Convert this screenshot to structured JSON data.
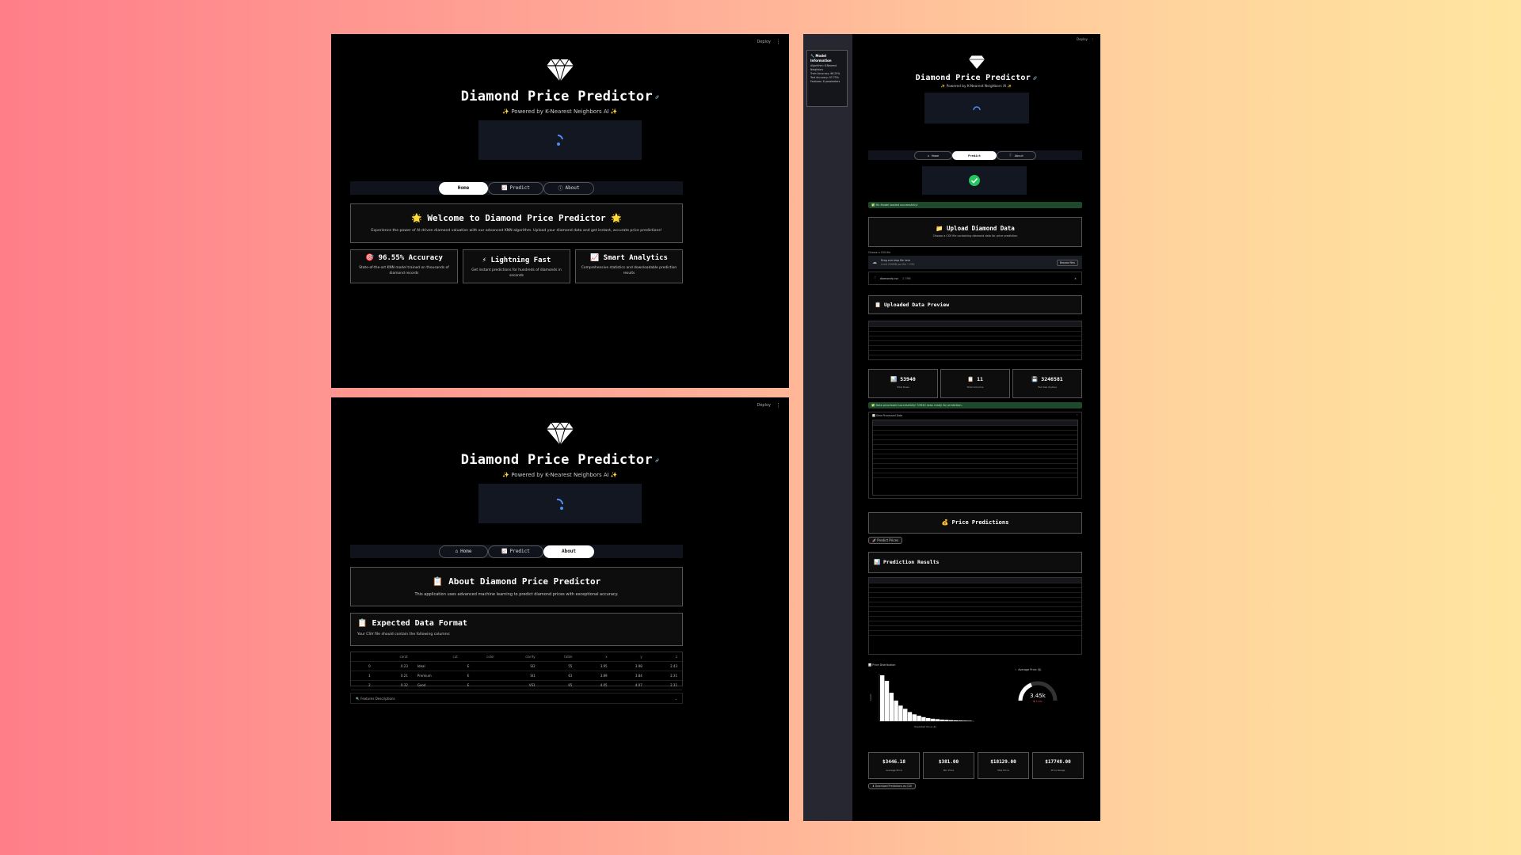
{
  "app": {
    "title": "Diamond Price Predictor",
    "subtitle": "✨ Powered by K-Nearest Neighbors AI ✨",
    "deploy_label": "Deploy",
    "menu_glyph": "⋮"
  },
  "tabs": [
    {
      "label": "Home",
      "icon": "home-icon"
    },
    {
      "label": "Predict",
      "icon": "chart-icon"
    },
    {
      "label": "About",
      "icon": "info-icon"
    }
  ],
  "home": {
    "welcome_title": "🌟 Welcome to Diamond Price Predictor 🌟",
    "welcome_text": "Experience the power of AI-driven diamond valuation with our advanced KNN algorithm. Upload your diamond data and get instant, accurate price predictions!",
    "features": [
      {
        "title": "🎯 96.55% Accuracy",
        "text": "State-of-the-art KNN model trained on thousands of diamond records"
      },
      {
        "title": "⚡ Lightning Fast",
        "text": "Get instant predictions for hundreds of diamonds in seconds"
      },
      {
        "title": "📈 Smart Analytics",
        "text": "Comprehensive statistics and downloadable prediction results"
      }
    ]
  },
  "about": {
    "title": "📋 About Diamond Price Predictor",
    "text": "This application uses advanced machine learning to predict diamond prices with exceptional accuracy.",
    "format_title": "📋 Expected Data Format",
    "format_text": "Your CSV file should contain the following columns:",
    "columns": [
      "",
      "carat",
      "cut",
      "color",
      "clarity",
      "table",
      "x",
      "y",
      "z"
    ],
    "rows": [
      [
        "0",
        "0.23",
        "Ideal",
        "E",
        "SI2",
        "55",
        "3.95",
        "3.98",
        "2.43"
      ],
      [
        "1",
        "0.21",
        "Premium",
        "E",
        "SI1",
        "61",
        "3.89",
        "3.84",
        "2.31"
      ],
      [
        "2",
        "0.32",
        "Good",
        "E",
        "VS1",
        "65",
        "4.05",
        "4.07",
        "2.31"
      ]
    ],
    "expander_label": "🔍 Features Descriptions"
  },
  "predict": {
    "sidebar": {
      "title": "🔧 Model Information",
      "lines": [
        "Algorithm: K-Nearest Neighbors",
        "Train Accuracy: 98.25%",
        "Test Accuracy: 97.75%",
        "Features: 6 parameters"
      ]
    },
    "model_loaded": "✅ ML Model loaded successfully!",
    "upload_title": "📁 Upload Diamond Data",
    "upload_text": "Choose a CSV file containing diamond data for price prediction",
    "upload_label": "Choose a CSV file",
    "drop_text": "Drag and drop file here",
    "drop_limit": "Limit 200MB per file • CSV",
    "browse_label": "Browse files",
    "file_name": "diamonds.csv",
    "file_size": "2.7MB",
    "preview_title": "📋 Uploaded Data Preview",
    "stats": [
      {
        "value": "53940",
        "label": "Total Rows"
      },
      {
        "value": "11",
        "label": "Total Columns"
      },
      {
        "value": "3246581",
        "label": "File Size (bytes)"
      }
    ],
    "processed_msg": "✅ Data processed successfully! 53940 rows ready for prediction.",
    "processed_label": "📊 View Processed Data",
    "predictions_title": "💰 Price Predictions",
    "predict_btn": "🚀 Predict Prices",
    "results_title": "📊 Prediction Results",
    "dist_label": "📊 Price Distribution",
    "dist_xlabel": "Predicted Price ($)",
    "dist_ylabel": "Count",
    "gauge_label": "🔹 Average Price ($)",
    "gauge_value": "3.45k",
    "gauge_delta": "▼ 3.45k",
    "summary": [
      {
        "value": "$3446.18",
        "label": "Average Price"
      },
      {
        "value": "$381.00",
        "label": "Min Price"
      },
      {
        "value": "$18129.00",
        "label": "Max Price"
      },
      {
        "value": "$17748.00",
        "label": "Price Range"
      }
    ],
    "download_btn": "⬇ Download Predictions as CSV"
  },
  "colors": {
    "page_bg": "#000000",
    "accent_blue": "#4f8df5",
    "success_green": "#22c55e",
    "card_border": "#555555"
  }
}
